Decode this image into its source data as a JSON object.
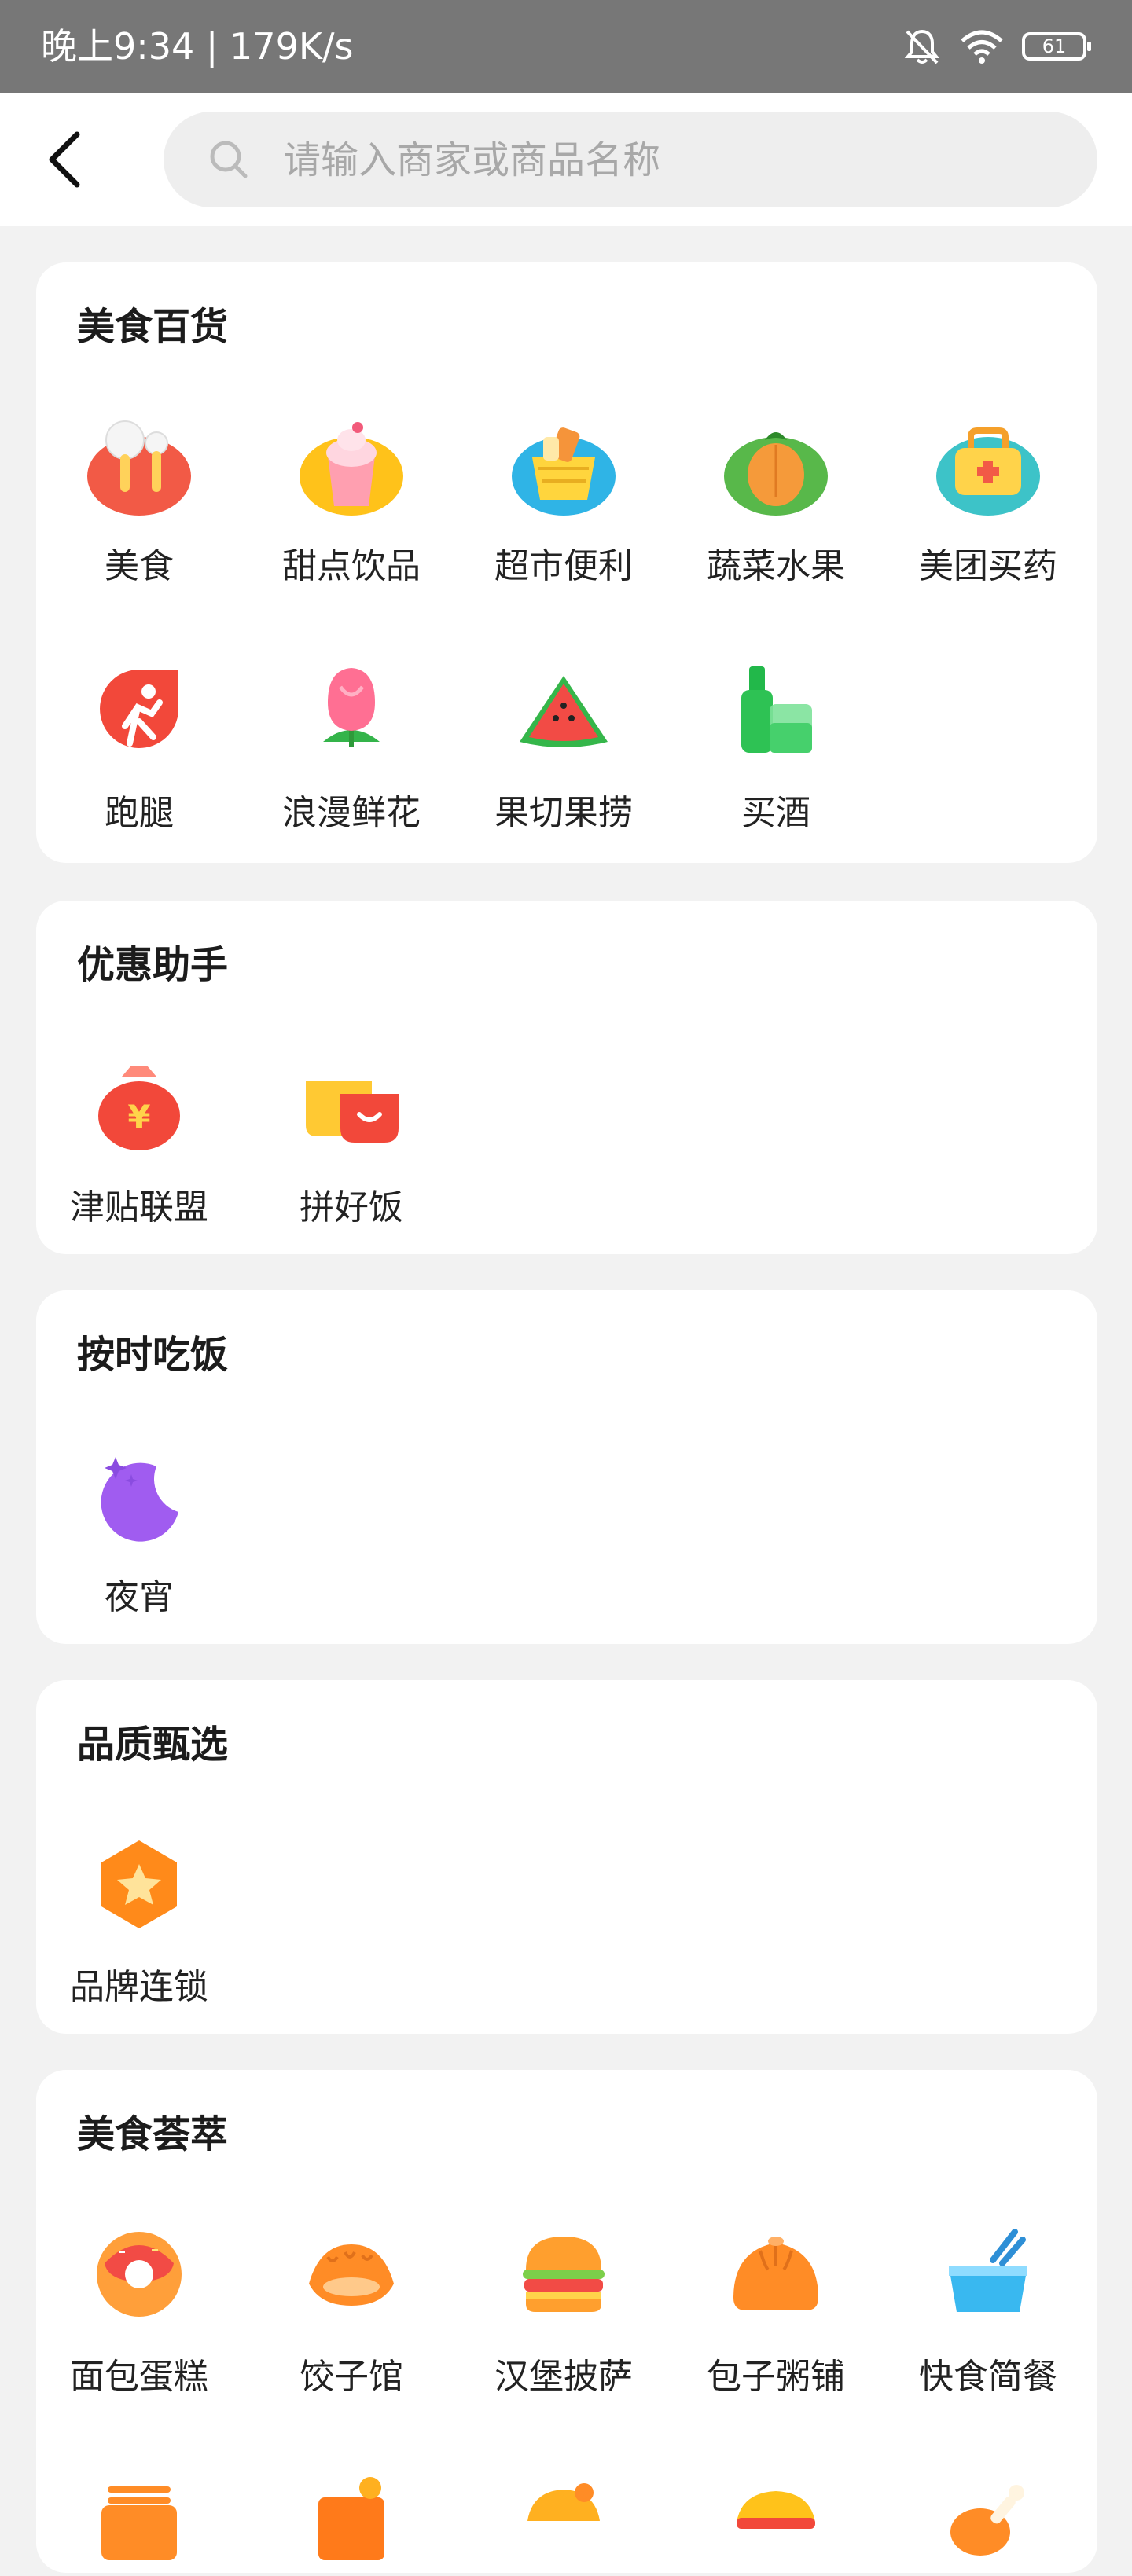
{
  "status_bar": {
    "time_speed": "晚上9:34 | 179K/s",
    "battery": "61"
  },
  "search": {
    "placeholder": "请输入商家或商品名称"
  },
  "sections": [
    {
      "title": "美食百货",
      "items": [
        {
          "label": "美食",
          "icon": "food-icon"
        },
        {
          "label": "甜点饮品",
          "icon": "dessert-icon"
        },
        {
          "label": "超市便利",
          "icon": "supermarket-icon"
        },
        {
          "label": "蔬菜水果",
          "icon": "vegetable-icon"
        },
        {
          "label": "美团买药",
          "icon": "medicine-icon"
        },
        {
          "label": "跑腿",
          "icon": "errand-icon"
        },
        {
          "label": "浪漫鲜花",
          "icon": "flower-icon"
        },
        {
          "label": "果切果捞",
          "icon": "watermelon-icon"
        },
        {
          "label": "买酒",
          "icon": "liquor-icon"
        }
      ]
    },
    {
      "title": "优惠助手",
      "items": [
        {
          "label": "津贴联盟",
          "icon": "money-bag-icon"
        },
        {
          "label": "拼好饭",
          "icon": "group-meal-icon"
        }
      ]
    },
    {
      "title": "按时吃饭",
      "items": [
        {
          "label": "夜宵",
          "icon": "moon-icon"
        }
      ]
    },
    {
      "title": "品质甄选",
      "items": [
        {
          "label": "品牌连锁",
          "icon": "star-badge-icon"
        }
      ]
    },
    {
      "title": "美食荟萃",
      "items": [
        {
          "label": "面包蛋糕",
          "icon": "donut-icon"
        },
        {
          "label": "饺子馆",
          "icon": "dumpling-icon"
        },
        {
          "label": "汉堡披萨",
          "icon": "burger-icon"
        },
        {
          "label": "包子粥铺",
          "icon": "bun-icon"
        },
        {
          "label": "快食简餐",
          "icon": "fastfood-icon"
        }
      ]
    }
  ]
}
